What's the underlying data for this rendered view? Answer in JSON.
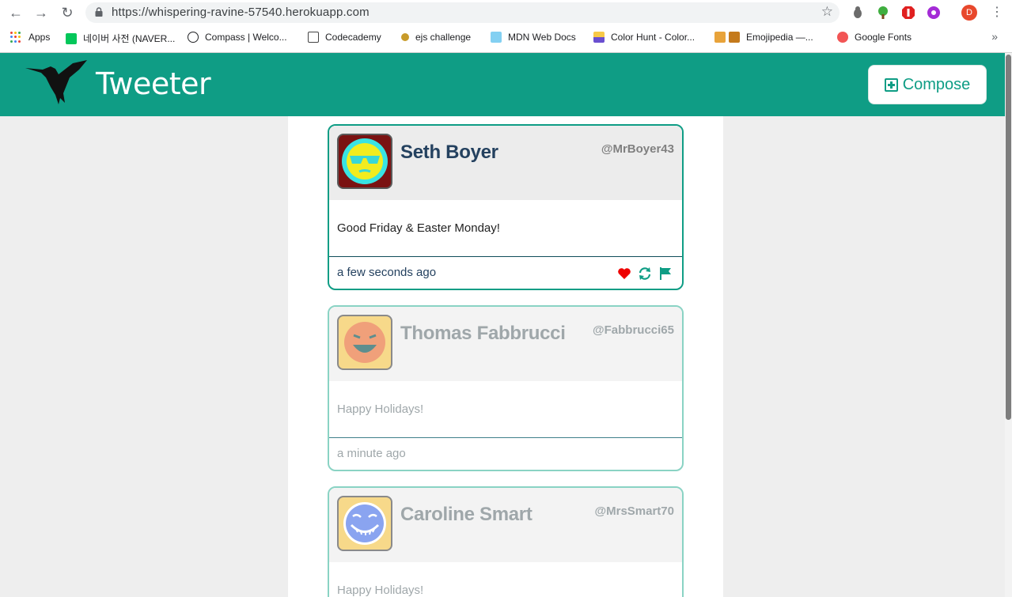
{
  "browser": {
    "url": "https://whispering-ravine-57540.herokuapp.com",
    "profile_initial": "D",
    "bookmarks": [
      {
        "label": "Apps",
        "icon": "apps-grid-icon",
        "color": "#1a73e8"
      },
      {
        "label": "네이버 사전 (NAVER...",
        "icon": "naver-dict-icon",
        "color": "#03c75a"
      },
      {
        "label": "Compass | Welco...",
        "icon": "compass-icon",
        "color": "#202124"
      },
      {
        "label": "Codecademy",
        "icon": "codecademy-icon",
        "color": "#444444"
      },
      {
        "label": "ejs challenge",
        "icon": "ejs-icon",
        "color": "#c89b2a"
      },
      {
        "label": "MDN Web Docs",
        "icon": "mdn-icon",
        "color": "#83d0f2"
      },
      {
        "label": "Color Hunt - Color...",
        "icon": "colorhunt-icon",
        "color": "#f7c948"
      },
      {
        "label": "Emojipedia —...",
        "icon": "emojipedia-icon",
        "color": "#e8a33a"
      },
      {
        "label": "Google Fonts",
        "icon": "google-fonts-icon",
        "color": "#f25555"
      }
    ]
  },
  "app": {
    "title": "Tweeter",
    "compose_label": "Compose",
    "accent": "#0f9d85"
  },
  "tweets": [
    {
      "name": "Seth Boyer",
      "handle": "@MrBoyer43",
      "text": "Good Friday & Easter Monday!",
      "time": "a few seconds ago",
      "avatar": "sunglasses-face-icon"
    },
    {
      "name": "Thomas Fabbrucci",
      "handle": "@Fabbrucci65",
      "text": "Happy Holidays!",
      "time": "a minute ago",
      "avatar": "laughing-face-icon"
    },
    {
      "name": "Caroline Smart",
      "handle": "@MrsSmart70",
      "text": "Happy Holidays!",
      "time": "",
      "avatar": "grinning-face-icon"
    }
  ]
}
